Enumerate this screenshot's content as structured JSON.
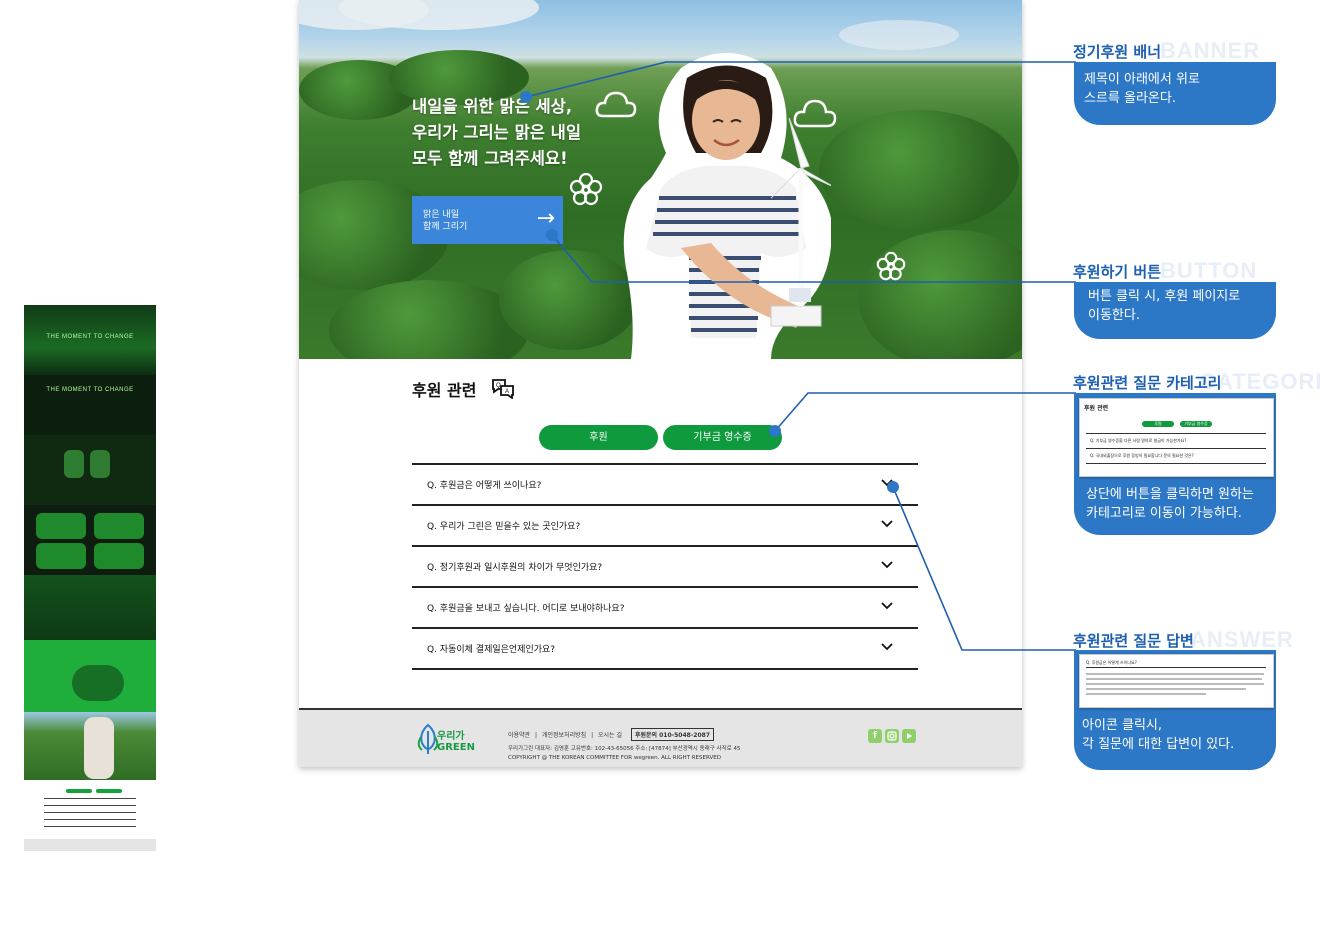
{
  "hero": {
    "title_lines": [
      "내일을 위한 맑은 세상,",
      "우리가 그리는 맑은 내일",
      "모두 함께 그려주세요!"
    ],
    "button_lines": [
      "맑은 내일",
      "함께 그리기"
    ],
    "button_arrow": "→"
  },
  "faq": {
    "title": "후원 관련",
    "categories": [
      "후원",
      "기부금 영수증"
    ],
    "questions": [
      "Q. 후원금은 어떻게 쓰이나요?",
      "Q. 우리가 그린은 믿을수 있는 곳인가요?",
      "Q. 정기후원과 일시후원의 차이가 무엇인가요?",
      "Q. 후원금을 보내고 싶습니다. 어디로 보내야하나요?",
      "Q. 자동이체 결제일은언제인가요?"
    ]
  },
  "footer": {
    "logo_lines": [
      "우리가",
      "GREEN"
    ],
    "links": [
      "이용약관",
      "|",
      "개인정보처리방침",
      "|",
      "오시는 길"
    ],
    "phone": "후원문의 010-5048-2087",
    "info_lines": [
      "우리가그린  대표자: 김영훈  고유번호: 102-43-65056  주소: [47874] 부산광역시 동래구 사직로 45",
      "COPYRIGHT @ THE KOREAN COMMITTEE FOR wegreen. ALL RIGHT RESERVED"
    ],
    "social_icons": [
      "facebook-icon",
      "instagram-icon",
      "youtube-icon"
    ]
  },
  "annotations": [
    {
      "title": "정기후원 배너",
      "bg_word": "BANNER",
      "desc": [
        "제목이 아래에서 위로",
        "스르륵 올라온다."
      ]
    },
    {
      "title": "후원하기 버튼",
      "bg_word": "BUTTON",
      "desc": [
        "버튼 클릭 시, 후원 페이지로",
        "이동한다."
      ]
    },
    {
      "title": "후원관련 질문 카테고리",
      "bg_word": "CATEGORIA",
      "desc": [
        "상단에 버튼을 클릭하면 원하는",
        "카테고리로 이동이 가능하다."
      ]
    },
    {
      "title": "후원관련 질문 답변",
      "bg_word": "ANSWER",
      "desc": [
        "아이콘 클릭시,",
        "각 질문에 대한 답변이 있다."
      ]
    }
  ],
  "mini_category": {
    "title": "후원 관련",
    "buttons": [
      "후원",
      "기부금 영수증"
    ],
    "rows": [
      "Q. 기부금 영수증을 다른 사람 명의로 발급이 가능한가요?",
      "Q. 국내외출장으로 후원 증빙이 필요합니다 문의 필요한 것은?"
    ]
  },
  "mini_answer": {
    "question": "Q. 후원금은 어떻게 쓰이나요?"
  },
  "thumbnail": {
    "heading1": "THE MOMENT TO CHANGE",
    "heading2": "THE MOMENT TO CHANGE"
  },
  "colors": {
    "accent_blue": "#2d78c6",
    "brand_green": "#109a3e",
    "hero_button": "#3b86db"
  }
}
